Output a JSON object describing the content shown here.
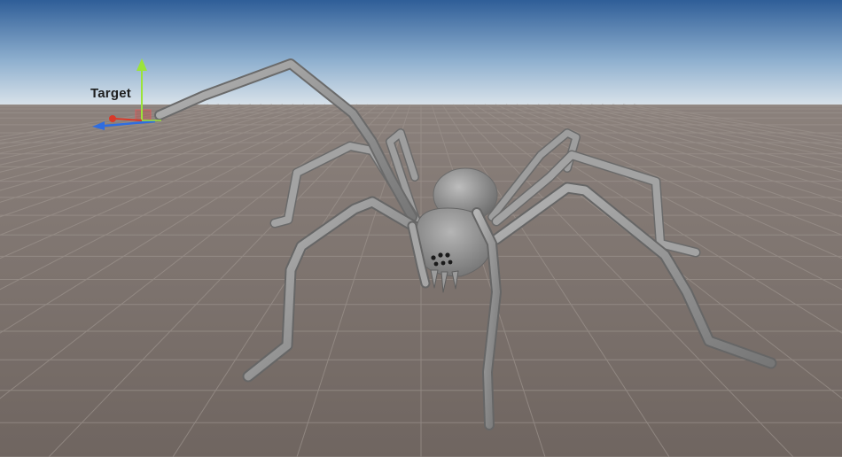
{
  "scene": {
    "gizmo": {
      "label": "Target",
      "axis_colors": {
        "x": "#d83a2a",
        "y": "#9be33a",
        "z": "#2f6de0"
      }
    },
    "colors": {
      "sky_top": "#2f5e98",
      "sky_horizon": "#dfe7ee",
      "ground": "#7a716c",
      "grid": "#9a918b",
      "spider_body": "#8a8a8a",
      "spider_shadow": "#5c5c5c",
      "spider_highlight": "#b9b9b9"
    }
  }
}
